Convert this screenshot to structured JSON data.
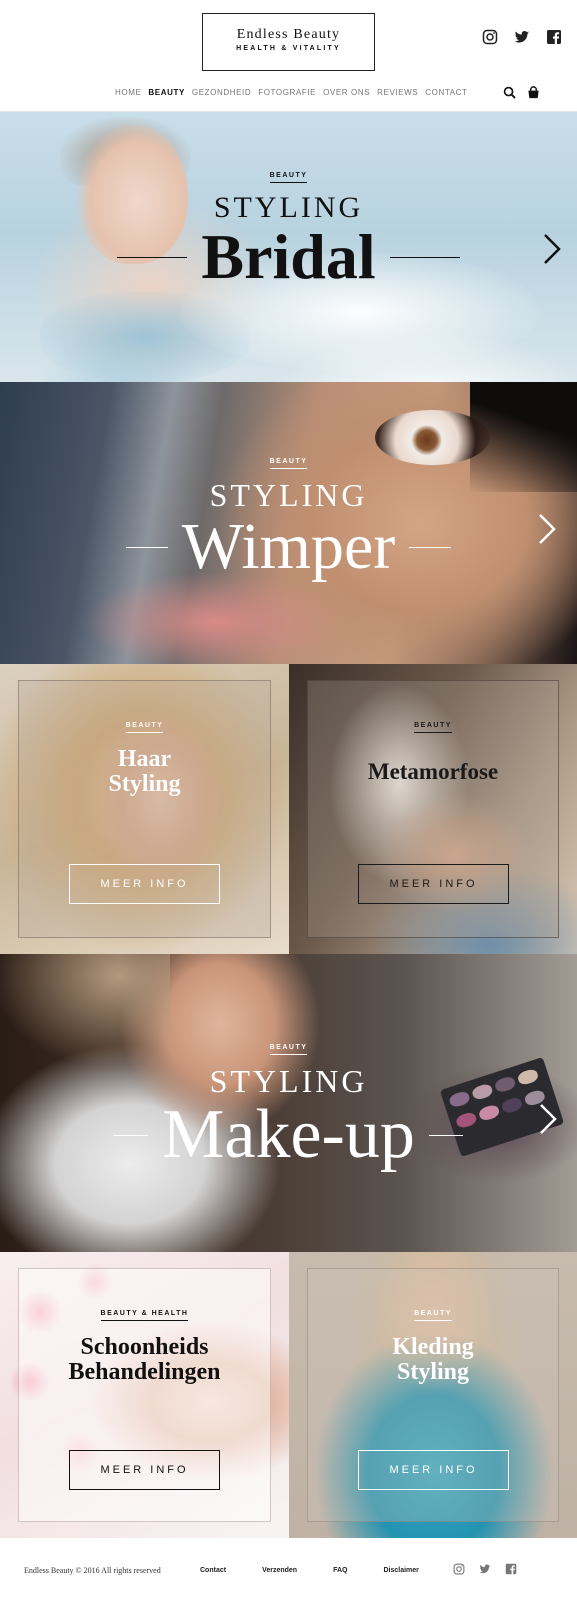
{
  "brand": {
    "title": "Endless Beauty",
    "subtitle": "HEALTH & VITALITY"
  },
  "social_icons": [
    "instagram-icon",
    "twitter-icon",
    "facebook-icon"
  ],
  "nav": {
    "items": [
      "HOME",
      "BEAUTY",
      "GEZONDHEID",
      "FOTOGRAFIE",
      "OVER ONS",
      "REVIEWS",
      "CONTACT"
    ],
    "active": "BEAUTY"
  },
  "tools": [
    "search-icon",
    "shopping-bag-icon"
  ],
  "heroes": [
    {
      "tag": "BEAUTY",
      "styling": "STYLING",
      "title": "Bridal"
    },
    {
      "tag": "BEAUTY",
      "styling": "STYLING",
      "title": "Wimper"
    },
    {
      "tag": "BEAUTY",
      "styling": "STYLING",
      "title": "Make-up"
    }
  ],
  "cards": [
    {
      "tag": "BEAUTY",
      "title": "Haar\nStyling",
      "button": "MEER INFO"
    },
    {
      "tag": "BEAUTY",
      "title": "Metamorfose",
      "button": "MEER INFO"
    },
    {
      "tag": "BEAUTY & HEALTH",
      "title": "Schoonheids\nBehandelingen",
      "button": "MEER INFO"
    },
    {
      "tag": "BEAUTY",
      "title": "Kleding\nStyling",
      "button": "MEER INFO"
    }
  ],
  "footer": {
    "copyright": "Endless Beauty © 2016 All rights reserved",
    "links": [
      "Contact",
      "Verzenden",
      "FAQ",
      "Disclaimer"
    ]
  },
  "colors": {
    "text_dark": "#111111",
    "nav_inactive": "#777777",
    "white": "#ffffff"
  }
}
